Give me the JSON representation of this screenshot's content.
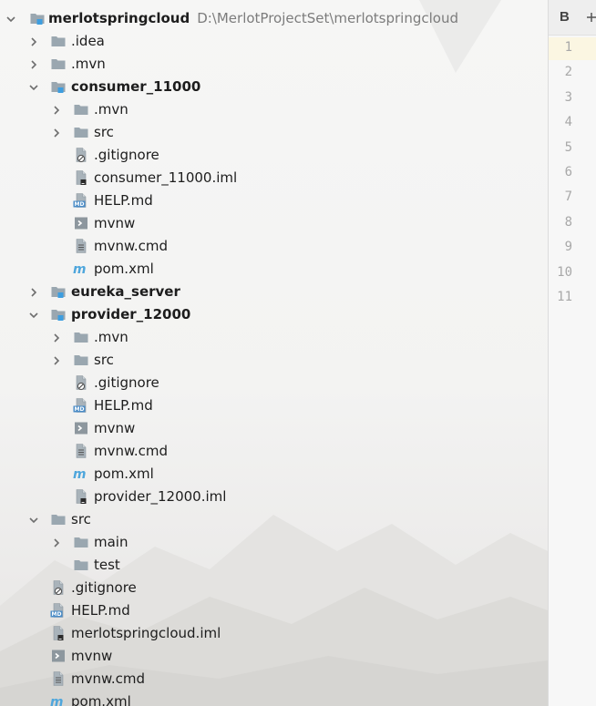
{
  "project_tree": {
    "rows": [
      {
        "label": "merlotspringcloud",
        "path": "D:\\MerlotProjectSet\\merlotspringcloud",
        "icon": "module-folder-icon",
        "arrow": "down",
        "level": 0,
        "bold": true
      },
      {
        "label": ".idea",
        "icon": "folder-icon",
        "arrow": "right",
        "level": 1
      },
      {
        "label": ".mvn",
        "icon": "folder-icon",
        "arrow": "right",
        "level": 1
      },
      {
        "label": "consumer_11000",
        "icon": "module-folder-icon",
        "arrow": "down",
        "level": 1,
        "bold": true
      },
      {
        "label": ".mvn",
        "icon": "folder-icon",
        "arrow": "right",
        "level": 2
      },
      {
        "label": "src",
        "icon": "folder-icon",
        "arrow": "right",
        "level": 2
      },
      {
        "label": ".gitignore",
        "icon": "gitignore-file-icon",
        "arrow": "none",
        "level": 2
      },
      {
        "label": "consumer_11000.iml",
        "icon": "iml-file-icon",
        "arrow": "none",
        "level": 2
      },
      {
        "label": "HELP.md",
        "icon": "markdown-file-icon",
        "arrow": "none",
        "level": 2
      },
      {
        "label": "mvnw",
        "icon": "shell-script-icon",
        "arrow": "none",
        "level": 2
      },
      {
        "label": "mvnw.cmd",
        "icon": "text-file-icon",
        "arrow": "none",
        "level": 2
      },
      {
        "label": "pom.xml",
        "icon": "maven-pom-icon",
        "arrow": "none",
        "level": 2
      },
      {
        "label": "eureka_server",
        "icon": "module-folder-icon",
        "arrow": "right",
        "level": 1,
        "bold": true
      },
      {
        "label": "provider_12000",
        "icon": "module-folder-icon",
        "arrow": "down",
        "level": 1,
        "bold": true
      },
      {
        "label": ".mvn",
        "icon": "folder-icon",
        "arrow": "right",
        "level": 2
      },
      {
        "label": "src",
        "icon": "folder-icon",
        "arrow": "right",
        "level": 2
      },
      {
        "label": ".gitignore",
        "icon": "gitignore-file-icon",
        "arrow": "none",
        "level": 2
      },
      {
        "label": "HELP.md",
        "icon": "markdown-file-icon",
        "arrow": "none",
        "level": 2
      },
      {
        "label": "mvnw",
        "icon": "shell-script-icon",
        "arrow": "none",
        "level": 2
      },
      {
        "label": "mvnw.cmd",
        "icon": "text-file-icon",
        "arrow": "none",
        "level": 2
      },
      {
        "label": "pom.xml",
        "icon": "maven-pom-icon",
        "arrow": "none",
        "level": 2
      },
      {
        "label": "provider_12000.iml",
        "icon": "iml-file-icon",
        "arrow": "none",
        "level": 2
      },
      {
        "label": "src",
        "icon": "folder-icon",
        "arrow": "down",
        "level": 1
      },
      {
        "label": "main",
        "icon": "folder-icon",
        "arrow": "right",
        "level": 2
      },
      {
        "label": "test",
        "icon": "folder-icon",
        "arrow": "none",
        "level": 2
      },
      {
        "label": ".gitignore",
        "icon": "gitignore-file-icon",
        "arrow": "none",
        "level": 1
      },
      {
        "label": "HELP.md",
        "icon": "markdown-file-icon",
        "arrow": "none",
        "level": 1
      },
      {
        "label": "merlotspringcloud.iml",
        "icon": "iml-file-icon",
        "arrow": "none",
        "level": 1
      },
      {
        "label": "mvnw",
        "icon": "shell-script-icon",
        "arrow": "none",
        "level": 1
      },
      {
        "label": "mvnw.cmd",
        "icon": "text-file-icon",
        "arrow": "none",
        "level": 1
      },
      {
        "label": "pom.xml",
        "icon": "maven-pom-icon",
        "arrow": "none",
        "level": 1
      }
    ]
  },
  "editor": {
    "bold_button_label": "B",
    "line_numbers": [
      "1",
      "2",
      "3",
      "4",
      "5",
      "6",
      "7",
      "8",
      "9",
      "10",
      "11"
    ],
    "current_line": "1"
  },
  "colors": {
    "folder": "#9aa7b0",
    "module_badge": "#3d9ee0",
    "maven": "#4ea6dc",
    "markdown_badge": "#4a8cc7",
    "current_line_bg": "#fbf6e2"
  }
}
